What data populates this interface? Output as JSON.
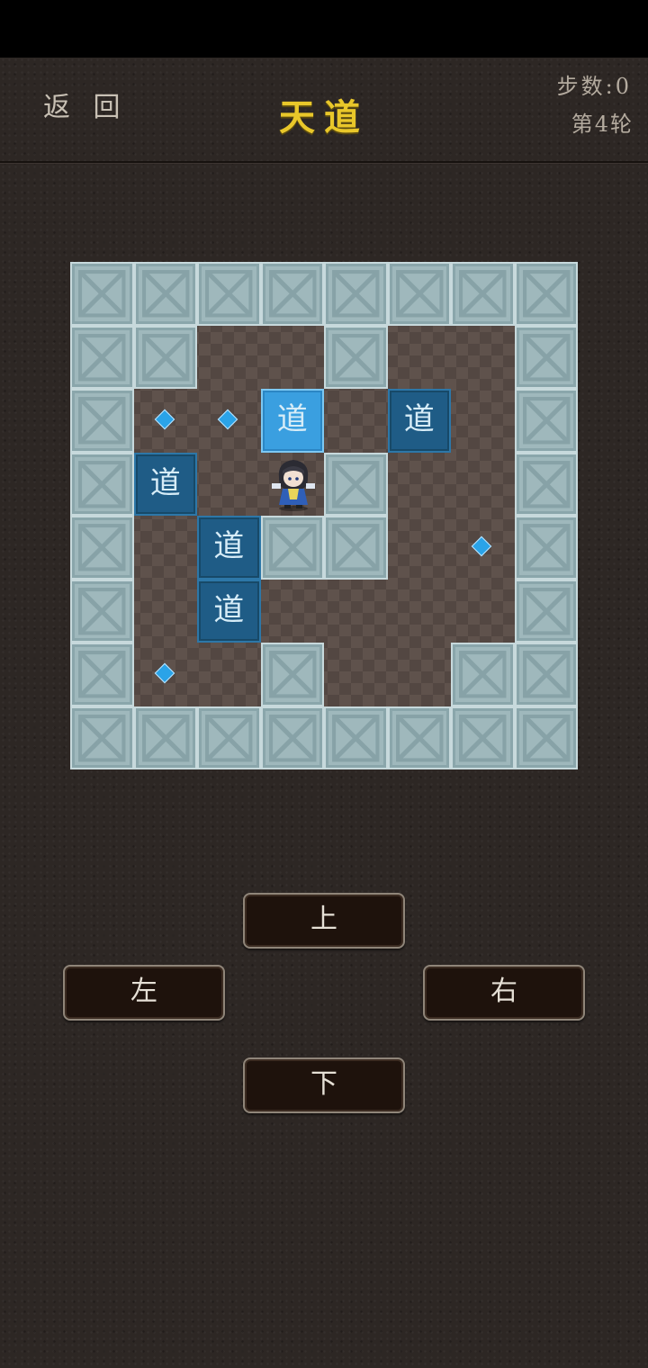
{
  "header": {
    "back_label": "返 回",
    "title": "天道",
    "steps": "步数:0",
    "round": "第4轮"
  },
  "board": {
    "box_label": "道",
    "rows": [
      "WWWWWWWW",
      "WW..W..W",
      "W.o*.B.W",
      "WB.PW..W",
      "W.BWW..W",
      "W.B....W",
      "W..W..WW",
      "WWWWWWWW"
    ],
    "goal_rows": [
      "........",
      "........",
      ".gg.....",
      "........",
      "......g.",
      "........",
      ".g....g.",
      "........"
    ],
    "legend": {
      "W": "wall",
      ".": "floor",
      "B": "box",
      "*": "box-on-goal",
      "P": "player",
      "g": "goal"
    }
  },
  "controls": {
    "up": "上",
    "left": "左",
    "right": "右",
    "down": "下"
  },
  "colors": {
    "title": "#e9c72a",
    "wall": "#9fb8bc",
    "box": "#1f5c86",
    "box_on_goal": "#3a9fe0",
    "goal": "#2aa3e8"
  }
}
